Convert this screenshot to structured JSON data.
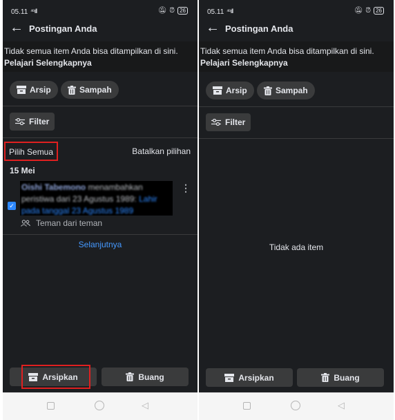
{
  "left": {
    "status": {
      "time": "05.11",
      "signal": "⁴⁶ıll",
      "battery": "26"
    },
    "header": {
      "title": "Postingan Anda"
    },
    "notice": {
      "text": "Tidak semua item Anda bisa ditampilkan di sini.",
      "learn_more": "Pelajari Selengkapnya"
    },
    "chips": {
      "archive": "Arsip",
      "trash": "Sampah"
    },
    "filter": "Filter",
    "select_all": "Pilih Semua",
    "deselect": "Batalkan pilihan",
    "date": "15 Mei",
    "post": {
      "name": "Oishi Tabemono",
      "action": " menambahkan peristiwa dari 23 Agustus 1989: ",
      "link": "Lahir pada tanggal 23 Agustus 1989",
      "audience": "Teman dari teman"
    },
    "next": "Selanjutnya",
    "bottom": {
      "archive": "Arsipkan",
      "delete": "Buang"
    }
  },
  "right": {
    "status": {
      "time": "05.11",
      "signal": "⁴⁶ıll",
      "battery": "26"
    },
    "header": {
      "title": "Postingan Anda"
    },
    "notice": {
      "text": "Tidak semua item Anda bisa ditampilkan di sini.",
      "learn_more": "Pelajari Selengkapnya"
    },
    "chips": {
      "archive": "Arsip",
      "trash": "Sampah"
    },
    "filter": "Filter",
    "empty": "Tidak ada item",
    "bottom": {
      "archive": "Arsipkan",
      "delete": "Buang"
    }
  },
  "colors": {
    "background": "#1c1e21",
    "surface": "#3a3b3c",
    "accent": "#2d88ff",
    "highlight": "#e02020"
  }
}
